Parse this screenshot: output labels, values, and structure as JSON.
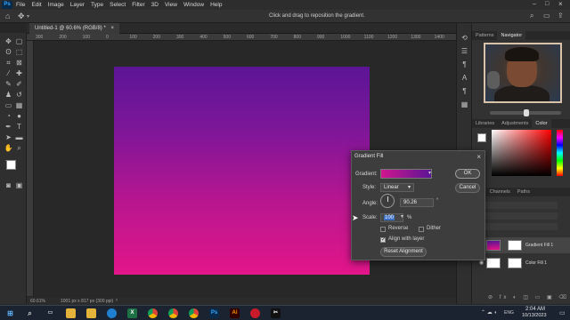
{
  "menu": {
    "app_logo": "Ps",
    "items": [
      "File",
      "Edit",
      "Image",
      "Layer",
      "Type",
      "Select",
      "Filter",
      "3D",
      "View",
      "Window",
      "Help"
    ]
  },
  "options_bar": {
    "hint": "Click and drag to reposition the gradient."
  },
  "document": {
    "tab_title": "Untitled-1 @ 60.6% (RGB/8) *",
    "ruler_ticks": [
      "300",
      "200",
      "100",
      "0",
      "100",
      "200",
      "300",
      "400",
      "500",
      "600",
      "700",
      "800",
      "900",
      "1000",
      "1100",
      "1200",
      "1300",
      "1400"
    ],
    "zoom": "60.61%",
    "doc_info": "1001 px x 817 px (300 ppi)",
    "gradient_colors": [
      "#5c1596",
      "#e3158a"
    ]
  },
  "panels": {
    "top_tabs": [
      "Patterns",
      "Navigator"
    ],
    "color_tabs": [
      "Libraries",
      "Adjustments",
      "Color"
    ],
    "layers_tabs": [
      "ers",
      "Channels",
      "Paths"
    ],
    "layers": [
      {
        "name": "Gradient Fill 1",
        "selected": true
      },
      {
        "name": "Color Fill 1",
        "selected": false
      }
    ]
  },
  "dialog": {
    "title": "Gradient Fill",
    "gradient_label": "Gradient:",
    "style_label": "Style:",
    "style_value": "Linear",
    "angle_label": "Angle:",
    "angle_value": "90.26",
    "angle_unit": "°",
    "scale_label": "Scale:",
    "scale_value": "100",
    "scale_unit": "%",
    "reverse_label": "Reverse",
    "reverse_checked": false,
    "dither_label": "Dither",
    "dither_checked": false,
    "align_label": "Align with layer",
    "align_checked": true,
    "reset_label": "Reset Alignment",
    "ok_label": "OK",
    "cancel_label": "Cancel",
    "close_glyph": "×"
  },
  "taskbar": {
    "icons": [
      "windows-start",
      "search",
      "file-explorer",
      "edge",
      "excel",
      "chrome",
      "chrome",
      "chrome",
      "chrome",
      "photoshop",
      "illustrator",
      "opera",
      "capcut"
    ],
    "time": "2:04 AM",
    "date": "10/13/2023",
    "lang": "ENG"
  }
}
